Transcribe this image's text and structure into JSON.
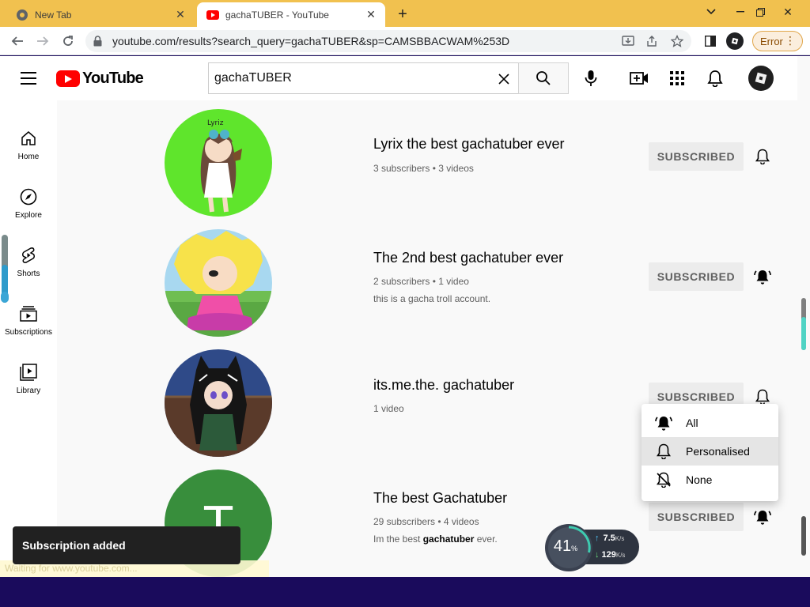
{
  "browser": {
    "tabs": [
      {
        "title": "New Tab",
        "icon": "chrome-icon"
      },
      {
        "title": "gachaTUBER - YouTube",
        "icon": "youtube-favicon"
      }
    ],
    "url": "youtube.com/results?search_query=gachaTUBER&sp=CAMSBBACWAM%253D",
    "error_label": "Error",
    "status_text": "Waiting for www.youtube.com..."
  },
  "youtube": {
    "logo_text": "YouTube",
    "search_value": "gachaTUBER",
    "guide": [
      {
        "label": "Home",
        "icon": "home-icon"
      },
      {
        "label": "Explore",
        "icon": "compass-icon"
      },
      {
        "label": "Shorts",
        "icon": "shorts-icon"
      },
      {
        "label": "Subscriptions",
        "icon": "subscriptions-icon"
      },
      {
        "label": "Library",
        "icon": "library-icon"
      }
    ],
    "channels": [
      {
        "name": "Lyrix the best gachatuber ever",
        "meta": "3 subscribers • 3 videos",
        "desc": "",
        "button": "SUBSCRIBED",
        "bell": "outline"
      },
      {
        "name": "The 2nd best gachatuber ever",
        "meta": "2 subscribers • 1 video",
        "desc": "this is a gacha troll account.",
        "button": "SUBSCRIBED",
        "bell": "filled"
      },
      {
        "name": "its.me.the. gachatuber",
        "meta": "1 video",
        "desc": "",
        "button": "SUBSCRIBED",
        "bell": "outline"
      },
      {
        "name": "The best Gachatuber",
        "meta": "29 subscribers • 4 videos",
        "desc_pre": "Im the best ",
        "desc_bold": "gachatuber",
        "desc_post": " ever.",
        "avatar_letter": "T",
        "button": "SUBSCRIBED",
        "bell": "filled"
      }
    ],
    "notification_menu": {
      "items": [
        {
          "label": "All",
          "icon": "bell-ringing-icon"
        },
        {
          "label": "Personalised",
          "icon": "bell-outline-icon",
          "selected": true
        },
        {
          "label": "None",
          "icon": "bell-off-icon"
        }
      ]
    },
    "toast": "Subscription added"
  },
  "net_widget": {
    "percent": "41",
    "percent_sign": "%",
    "upload": "7.5",
    "upload_unit": "K/s",
    "download": "129",
    "download_unit": "K/s"
  },
  "colors": {
    "tabstrip": "#f1c14f",
    "youtube_red": "#ff0000",
    "taskbar": "#1a0b5c",
    "error_accent": "#e0a64a"
  }
}
